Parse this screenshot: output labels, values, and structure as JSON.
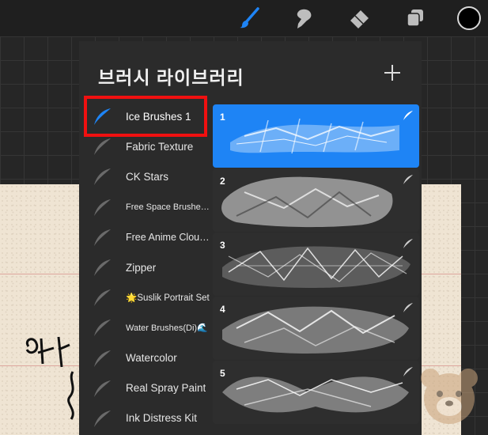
{
  "toolbar": {
    "tools": [
      {
        "name": "brush-icon",
        "active": true
      },
      {
        "name": "smudge-icon",
        "active": false
      },
      {
        "name": "eraser-icon",
        "active": false
      },
      {
        "name": "layers-icon",
        "active": false
      }
    ],
    "color": "#000000"
  },
  "panel": {
    "title": "브러시 라이브러리",
    "add_icon": "plus-icon"
  },
  "brush_sets": [
    {
      "label": "Ice Brushes 1",
      "selected": true
    },
    {
      "label": "Fabric Texture",
      "selected": false
    },
    {
      "label": "CK Stars",
      "selected": false
    },
    {
      "label": "Free Space Brushes (...",
      "selected": false
    },
    {
      "label": "Free Anime Clouds",
      "selected": false
    },
    {
      "label": "Zipper",
      "selected": false
    },
    {
      "label": "🌟Suslik Portrait Set",
      "selected": false
    },
    {
      "label": "Water Brushes(Di)🌊",
      "selected": false
    },
    {
      "label": "Watercolor",
      "selected": false
    },
    {
      "label": "Real Spray Paint",
      "selected": false
    },
    {
      "label": "Ink Distress Kit",
      "selected": false
    }
  ],
  "brushes": [
    {
      "number": "1",
      "selected": true
    },
    {
      "number": "2",
      "selected": false
    },
    {
      "number": "3",
      "selected": false
    },
    {
      "number": "4",
      "selected": false
    },
    {
      "number": "5",
      "selected": false
    }
  ],
  "colors": {
    "accent": "#1e84f5",
    "highlight": "#f01010",
    "panel": "#2b2b2b"
  }
}
